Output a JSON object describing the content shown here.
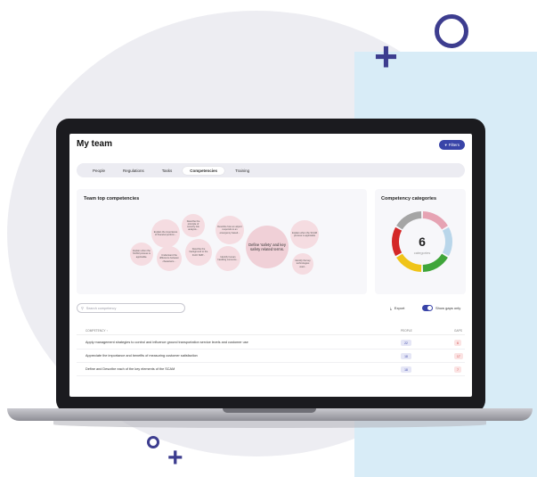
{
  "header": {
    "title": "My team",
    "filters_label": "Filters"
  },
  "tabs": [
    {
      "label": "People",
      "active": false
    },
    {
      "label": "Regulations",
      "active": false
    },
    {
      "label": "Tasks",
      "active": false
    },
    {
      "label": "Competencies",
      "active": true
    },
    {
      "label": "Training",
      "active": false
    }
  ],
  "top_competencies": {
    "title": "Team top competencies",
    "bubbles": [
      "Explain when the SCAM process is applicable.",
      "Explain the importance of financial perform...",
      "Describe the principle of security risk analysis...",
      "Describe how an airport responds to an emergency based...",
      "Define 'safety' and key safety related terms.",
      "Explain when the SCAM process is applicable",
      "Understand the difference between characteris...",
      "Describe the background to the ICAO SMP...",
      "Identify human handling concerns...",
      "Identify the key technologies used..."
    ]
  },
  "categories": {
    "title": "Competency categories",
    "count": "6",
    "count_label": "categories",
    "colors": [
      "#e6a3b3",
      "#b9d6ea",
      "#3fa53a",
      "#f0c419",
      "#d42727",
      "#a5a5a5"
    ]
  },
  "search": {
    "placeholder": "Search competency"
  },
  "actions": {
    "export_label": "Export",
    "show_gaps_label": "Show gaps only"
  },
  "table": {
    "headers": {
      "competency": "COMPETENCY ↑",
      "people": "PEOPLE",
      "gaps": "GAPS"
    },
    "rows": [
      {
        "competency": "Apply management strategies to control and influence ground transportation service levels and customer use",
        "people": "22",
        "gaps": "6"
      },
      {
        "competency": "Appreciate the importance and benefits of measuring customer satisfaction",
        "people": "18",
        "gaps": "17"
      },
      {
        "competency": "Define and Describe each of the key elements of the SCAM",
        "people": "18",
        "gaps": "7"
      }
    ]
  }
}
